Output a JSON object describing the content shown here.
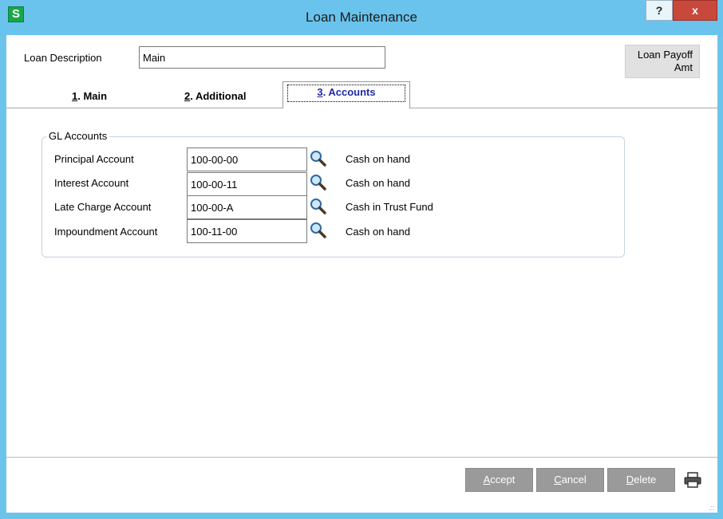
{
  "window": {
    "title": "Loan Maintenance",
    "app_icon_letter": "S",
    "help_label": "?",
    "close_label": "x"
  },
  "header": {
    "loan_description_label": "Loan Description",
    "loan_description_value": "Main",
    "payoff_label_line1": "Loan Payoff",
    "payoff_label_line2": "Amt"
  },
  "tabs": [
    {
      "num": "1",
      "label": ". Main"
    },
    {
      "num": "2",
      "label": ". Additional"
    },
    {
      "num": "3",
      "label": ". Accounts"
    }
  ],
  "gl_accounts": {
    "group_title": "GL Accounts",
    "rows": [
      {
        "label": "Principal Account",
        "value": "100-00-00",
        "description": "Cash on hand"
      },
      {
        "label": "Interest Account",
        "value": "100-00-11",
        "description": "Cash on hand"
      },
      {
        "label": "Late Charge Account",
        "value": "100-00-A",
        "description": "Cash in Trust Fund"
      },
      {
        "label": "Impoundment Account",
        "value": "100-11-00",
        "description": "Cash on hand"
      }
    ]
  },
  "footer": {
    "accept_first": "A",
    "accept_rest": "ccept",
    "cancel_first": "C",
    "cancel_rest": "ancel",
    "delete_first": "D",
    "delete_rest": "elete"
  },
  "colors": {
    "title_bar": "#69c3ec",
    "close_button": "#c9483c",
    "active_tab_text": "#1f2aa8",
    "footer_button": "#9a9a9a"
  }
}
